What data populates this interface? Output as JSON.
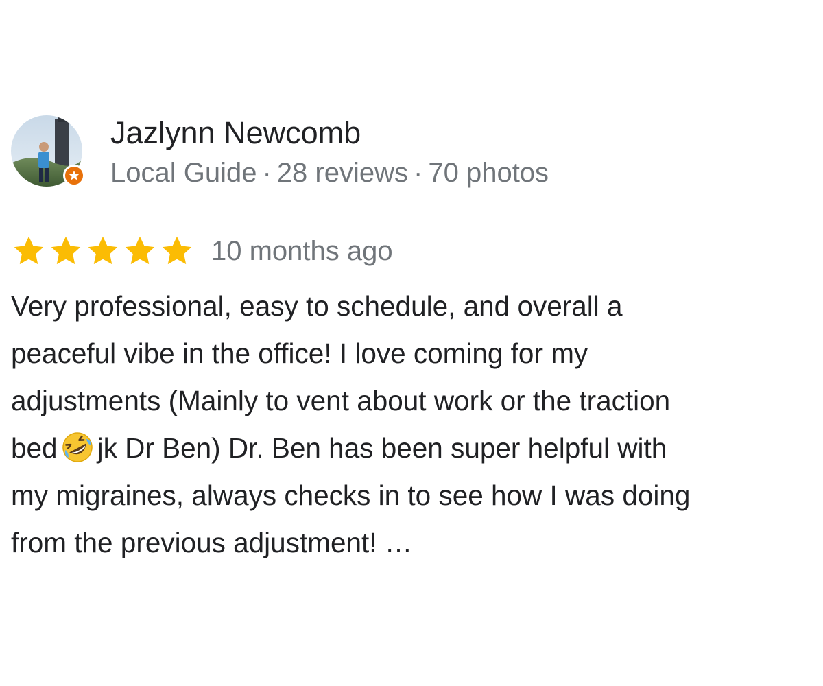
{
  "reviewer": {
    "name": "Jazlynn Newcomb",
    "badge": "Local Guide",
    "separator": "·",
    "reviews": "28 reviews",
    "photos": "70 photos",
    "avatar_icon": "profile-photo",
    "badge_icon": "local-guide-star-icon",
    "badge_color": "#e8710a"
  },
  "rating": {
    "stars": 5,
    "max_stars": 5,
    "star_color": "#fbbc04",
    "date": "10 months ago"
  },
  "review": {
    "lines": [
      "Very professional, easy to schedule, and overall a",
      "peaceful vibe in the office! I love coming for my",
      "adjustments (Mainly to vent about work or the traction",
      "bed",
      "jk Dr Ben) Dr. Ben has been super helpful with",
      "my migraines, always checks in to see how I was doing",
      "from the previous adjustment!",
      "…"
    ],
    "emoji_icon": "rolling-on-floor-laughing-emoji-icon"
  },
  "colors": {
    "text_primary": "#202124",
    "text_secondary": "#70757a"
  }
}
